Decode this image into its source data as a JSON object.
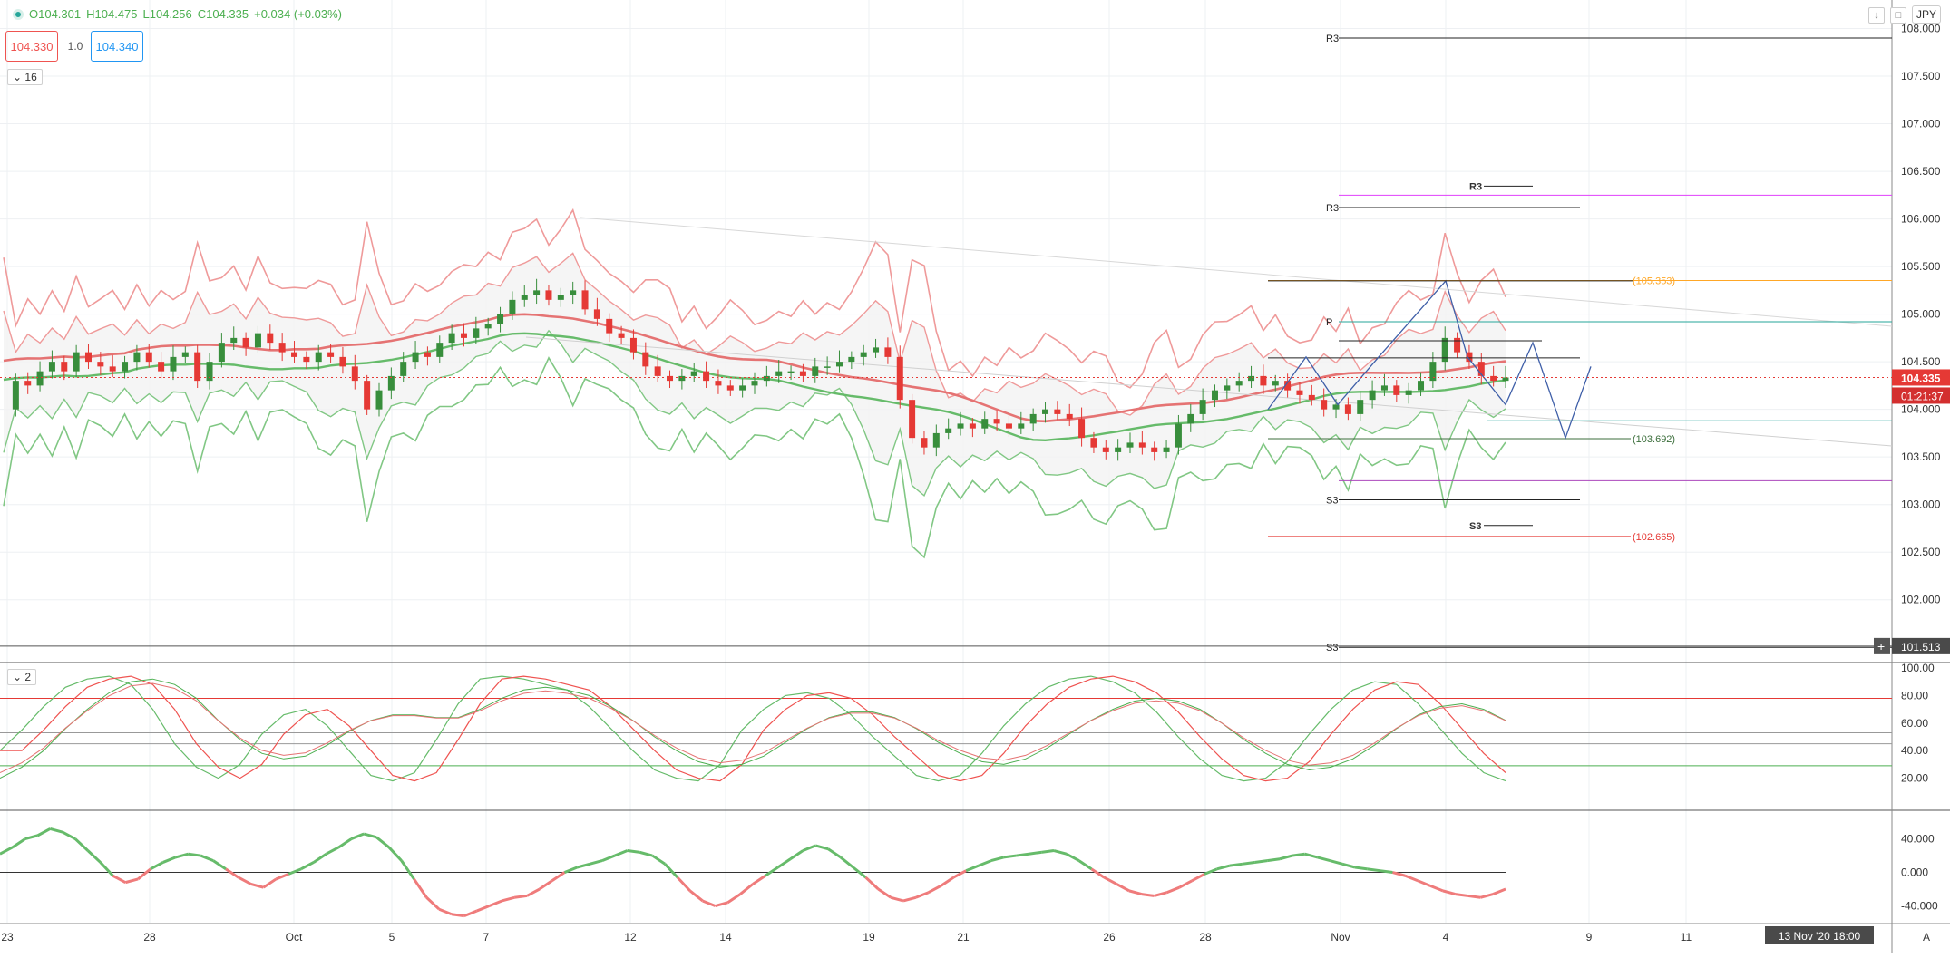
{
  "header": {
    "open": "O104.301",
    "high": "H104.475",
    "low": "L104.256",
    "close": "C104.335",
    "change": "+0.034 (+0.03%)"
  },
  "trade": {
    "sell": "104.330",
    "spread": "1.0",
    "buy": "104.340"
  },
  "collapse": {
    "main": "16",
    "stoch": "2"
  },
  "currency": "JPY",
  "icons": {
    "down": "arrow-down-icon",
    "maximize": "maximize-icon"
  },
  "colors": {
    "up": "#388e3c",
    "down": "#e53935",
    "bb_upper": "#ef9a9a",
    "bb_lower": "#81c784",
    "ma": "#e57373",
    "orange": "#ffa726",
    "pivot_magenta": "#e040fb",
    "teal": "#26a69a"
  },
  "chart_data": [
    {
      "type": "candlestick",
      "title": "",
      "x_ticks": [
        "23",
        "28",
        "Oct",
        "5",
        "7",
        "12",
        "14",
        "19",
        "21",
        "26",
        "28",
        "Nov",
        "4",
        "9",
        "11"
      ],
      "y_ticks": [
        "108.000",
        "107.500",
        "107.000",
        "106.500",
        "106.000",
        "105.500",
        "105.000",
        "104.500",
        "104.000",
        "103.500",
        "103.000",
        "102.500",
        "102.000"
      ],
      "ylim": [
        101.35,
        108.3
      ],
      "grid": true,
      "current_price": "104.335",
      "countdown": "01:21:37",
      "crosshair_price": "101.513",
      "crosshair_date": "13 Nov '20  18:00",
      "candle_path": [
        104.0,
        104.3,
        104.25,
        104.4,
        104.5,
        104.4,
        104.6,
        104.5,
        104.45,
        104.4,
        104.5,
        104.6,
        104.5,
        104.4,
        104.55,
        104.6,
        104.3,
        104.5,
        104.7,
        104.75,
        104.65,
        104.8,
        104.7,
        104.6,
        104.55,
        104.5,
        104.6,
        104.55,
        104.45,
        104.3,
        104.0,
        104.2,
        104.35,
        104.5,
        104.6,
        104.55,
        104.7,
        104.8,
        104.75,
        104.85,
        104.9,
        105.0,
        105.15,
        105.2,
        105.25,
        105.15,
        105.2,
        105.25,
        105.05,
        104.95,
        104.8,
        104.75,
        104.6,
        104.45,
        104.35,
        104.3,
        104.35,
        104.4,
        104.3,
        104.25,
        104.2,
        104.25,
        104.3,
        104.35,
        104.4,
        104.4,
        104.35,
        104.45,
        104.45,
        104.5,
        104.55,
        104.6,
        104.65,
        104.55,
        104.1,
        103.7,
        103.6,
        103.75,
        103.8,
        103.85,
        103.8,
        103.9,
        103.85,
        103.8,
        103.85,
        103.95,
        104.0,
        103.95,
        103.9,
        103.7,
        103.6,
        103.55,
        103.6,
        103.65,
        103.6,
        103.55,
        103.6,
        103.85,
        103.95,
        104.1,
        104.2,
        104.25,
        104.3,
        104.35,
        104.25,
        104.3,
        104.2,
        104.15,
        104.1,
        104.0,
        104.05,
        103.95,
        104.1,
        104.2,
        104.25,
        104.15,
        104.2,
        104.3,
        104.5,
        104.75,
        104.6,
        104.5,
        104.35,
        104.3,
        104.335
      ],
      "levels": [
        {
          "label": "R3",
          "value": 107.9
        },
        {
          "label": "R3",
          "value": 106.25
        },
        {
          "label": "R3",
          "value": 106.12
        },
        {
          "label": "(105.353)",
          "value": 105.353
        },
        {
          "label": "P",
          "value": 104.92
        },
        {
          "label": "(103.692)",
          "value": 103.692
        },
        {
          "label": "S3",
          "value": 103.05
        },
        {
          "label": "S3",
          "value": 102.78
        },
        {
          "label": "(102.665)",
          "value": 102.665
        },
        {
          "label": "S3",
          "value": 101.5
        }
      ]
    },
    {
      "type": "line",
      "title": "",
      "y_ticks": [
        "100.00",
        "80.00",
        "60.00",
        "40.00",
        "20.00"
      ],
      "ylim": [
        0,
        100
      ],
      "bands": [
        78,
        53,
        45,
        29
      ],
      "series": [
        {
          "values": [
            40,
            55,
            72,
            86,
            92,
            94,
            88,
            70,
            45,
            28,
            20,
            30,
            52,
            66,
            70,
            58,
            40,
            22,
            18,
            24,
            48,
            74,
            92,
            94,
            92,
            88,
            84,
            72,
            56,
            40,
            26,
            20,
            18,
            30,
            55,
            70,
            80,
            82,
            78,
            66,
            50,
            36,
            22,
            18,
            22,
            38,
            58,
            74,
            86,
            92,
            94,
            90,
            82,
            68,
            50,
            34,
            22,
            18,
            20,
            32,
            52,
            70,
            84,
            90,
            88,
            74,
            56,
            38,
            24,
            18
          ]
        },
        {
          "values": [
            20,
            28,
            40,
            56,
            70,
            82,
            90,
            92,
            88,
            78,
            62,
            48,
            38,
            34,
            36,
            44,
            54,
            62,
            66,
            66,
            64,
            64,
            70,
            78,
            84,
            86,
            84,
            80,
            72,
            62,
            50,
            40,
            32,
            28,
            30,
            36,
            46,
            56,
            64,
            68,
            68,
            64,
            56,
            46,
            38,
            32,
            30,
            34,
            42,
            52,
            62,
            70,
            76,
            78,
            76,
            70,
            60,
            48,
            38,
            30,
            26,
            28,
            34,
            44,
            56,
            66,
            72,
            74,
            70,
            62
          ]
        }
      ]
    },
    {
      "type": "line",
      "title": "",
      "y_ticks": [
        "40.000",
        "0.000",
        "-40.000"
      ],
      "ylim": [
        -60,
        72
      ],
      "zero": 0,
      "series": [
        {
          "values": [
            22,
            30,
            40,
            44,
            52,
            48,
            40,
            26,
            12,
            -4,
            -12,
            -8,
            4,
            12,
            18,
            22,
            20,
            14,
            4,
            -6,
            -14,
            -18,
            -8,
            -2,
            4,
            12,
            22,
            30,
            40,
            46,
            42,
            30,
            14,
            -8,
            -30,
            -44,
            -50,
            -52,
            -46,
            -40,
            -34,
            -30,
            -28,
            -20,
            -10,
            0,
            6,
            10,
            14,
            20,
            26,
            24,
            20,
            10,
            -6,
            -22,
            -34,
            -40,
            -36,
            -26,
            -14,
            -4,
            6,
            16,
            26,
            32,
            28,
            18,
            6,
            -6,
            -20,
            -30,
            -34,
            -30,
            -24,
            -16,
            -6,
            2,
            8,
            14,
            18,
            20,
            22,
            24,
            26,
            22,
            14,
            4,
            -6,
            -14,
            -22,
            -26,
            -28,
            -24,
            -18,
            -10,
            -2,
            4,
            8,
            10,
            12,
            14,
            16,
            20,
            22,
            18,
            14,
            10,
            6,
            4,
            2,
            0,
            -4,
            -10,
            -16,
            -22,
            -26,
            -28,
            -30,
            -26,
            -20
          ]
        }
      ]
    }
  ]
}
